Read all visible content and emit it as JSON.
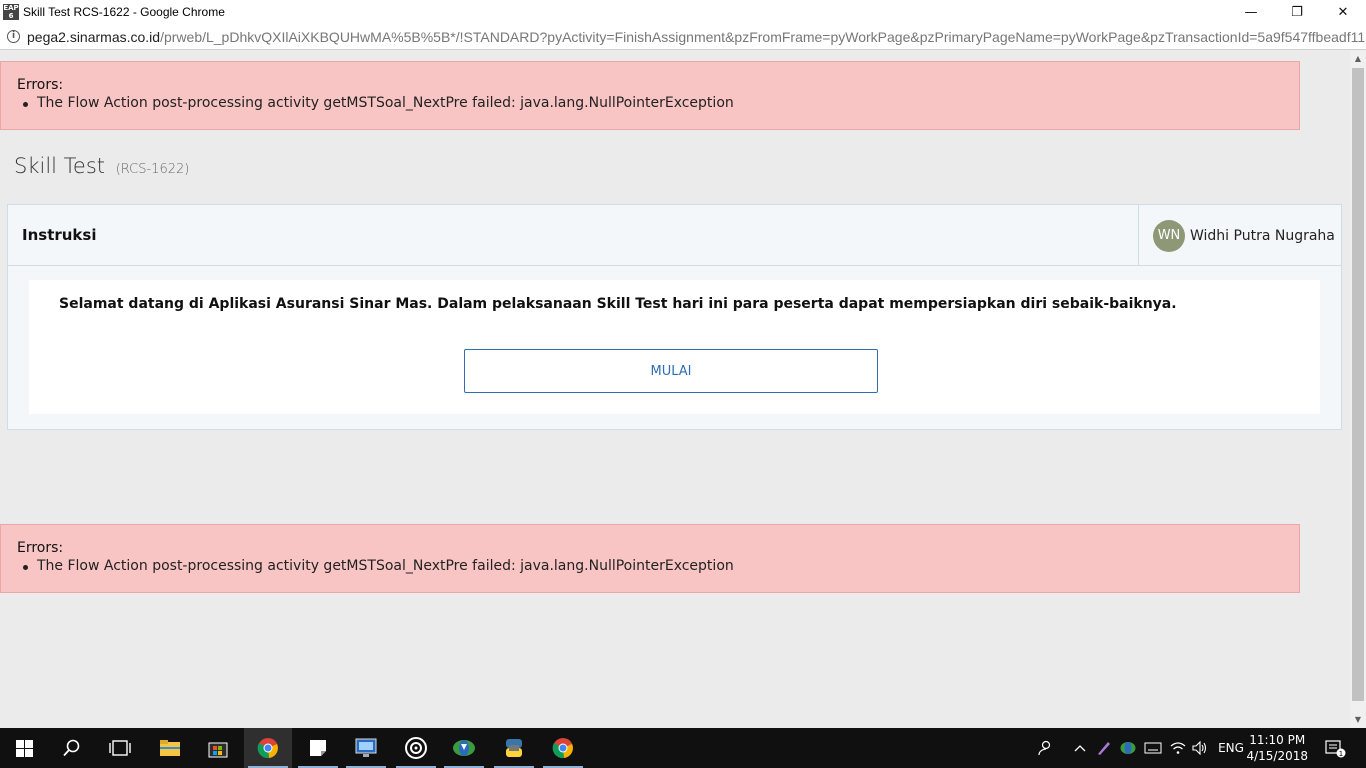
{
  "window": {
    "title": "Skill Test RCS-1622 - Google Chrome",
    "app_icon_text": "EAP 6",
    "controls": {
      "minimize": "—",
      "restore": "❐",
      "close": "✕"
    }
  },
  "address_bar": {
    "host": "pega2.sinarmas.co.id",
    "path": "/prweb/L_pDhkvQXIlAiXKBQUHwMA%5B%5B*/!STANDARD?pyActivity=FinishAssignment&pzFromFrame=pyWorkPage&pzPrimaryPageName=pyWorkPage&pzTransactionId=5a9f547ffbeadf11b..."
  },
  "errors_top": {
    "title": "Errors:",
    "items": [
      "The Flow Action post-processing activity getMSTSoal_NextPre failed: java.lang.NullPointerException"
    ]
  },
  "page": {
    "title": "Skill Test",
    "case_id": "(RCS-1622)"
  },
  "panel": {
    "title": "Instruksi",
    "user": {
      "initials": "WN",
      "name": "Widhi Putra Nugraha"
    },
    "welcome": "Selamat datang di Aplikasi Asuransi Sinar Mas. Dalam pelaksanaan Skill Test hari ini para peserta dapat mempersiapkan diri sebaik-baiknya.",
    "button_label": "MULAI"
  },
  "errors_bottom": {
    "title": "Errors:",
    "items": [
      "The Flow Action post-processing activity getMSTSoal_NextPre failed: java.lang.NullPointerException"
    ]
  },
  "taskbar": {
    "language": "ENG",
    "time": "11:10 PM",
    "date": "4/15/2018",
    "notification_count": "1",
    "colors": {
      "background": "#101010",
      "accent": "#8fb3d6"
    }
  }
}
